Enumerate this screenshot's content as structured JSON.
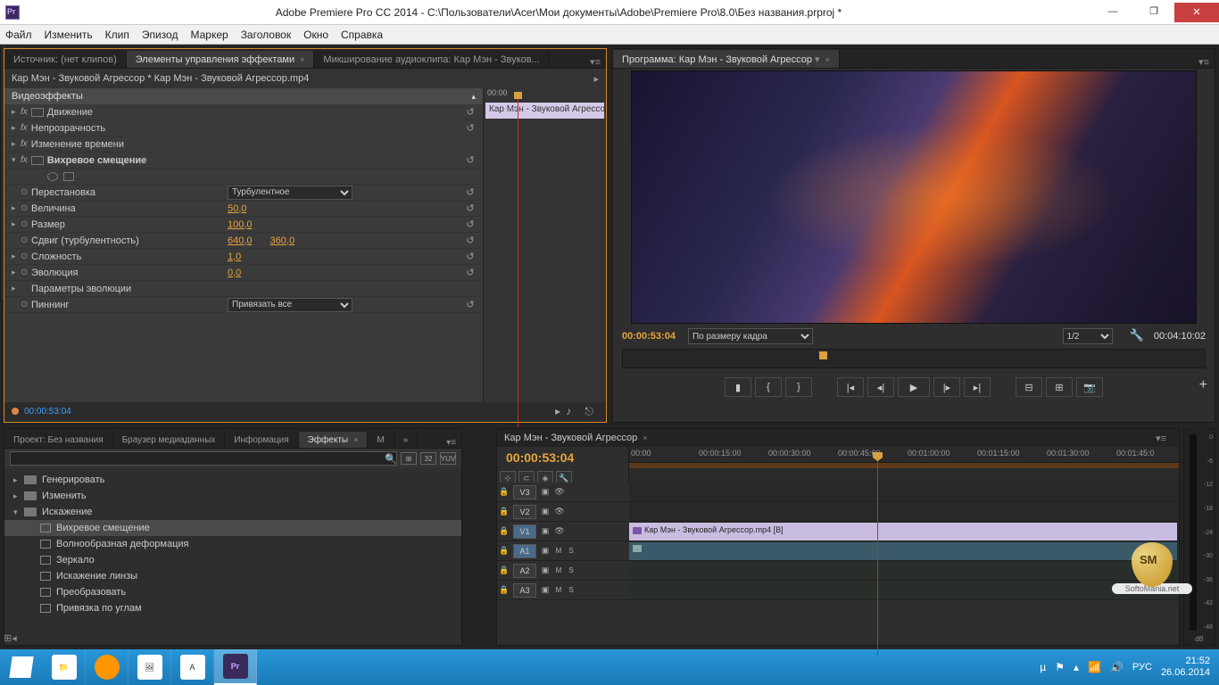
{
  "window": {
    "title": "Adobe Premiere Pro CC 2014 - C:\\Пользователи\\Acer\\Мои документы\\Adobe\\Premiere Pro\\8.0\\Без названия.prproj *"
  },
  "menu": [
    "Файл",
    "Изменить",
    "Клип",
    "Эпизод",
    "Маркер",
    "Заголовок",
    "Окно",
    "Справка"
  ],
  "fx_panel": {
    "tabs": {
      "source": "Источник: (нет клипов)",
      "controls": "Элементы управления эффектами",
      "mixer": "Микширование аудиоклипа: Кар Мэн - Звуков..."
    },
    "clip_path": "Кар Мэн - Звуковой Агрессор * Кар Мэн - Звуковой Агрессор.mp4",
    "section": "Видеоэффекты",
    "rows": {
      "motion": "Движение",
      "opacity": "Непрозрачность",
      "timeremap": "Изменение времени",
      "twirl": "Вихревое смещение",
      "swap": "Перестановка",
      "swap_val": "Турбулентное",
      "amount": "Величина",
      "amount_val": "50,0",
      "size": "Размер",
      "size_val": "100,0",
      "offset": "Сдвиг (турбулентность)",
      "offset_x": "640,0",
      "offset_y": "360,0",
      "complex": "Сложность",
      "complex_val": "1,0",
      "evolve": "Эволюция",
      "evolve_val": "0,0",
      "evparams": "Параметры эволюции",
      "pinning": "Пиннинг",
      "pinning_val": "Привязать все"
    },
    "mini_ruler": "00:00",
    "mini_clip": "Кар Мэн - Звуковой Агрессо",
    "timecode": "00:00:53:04"
  },
  "program": {
    "tab": "Программа: Кар Мэн - Звуковой Агрессор",
    "tc_left": "00:00:53:04",
    "zoom": "По размеру кадра",
    "res": "1/2",
    "tc_right": "00:04:10:02"
  },
  "project": {
    "tabs": {
      "project": "Проект: Без названия",
      "media": "Браузер медиаданных",
      "info": "Информация",
      "effects": "Эффекты",
      "m": "M",
      "arrow": "»"
    },
    "search_placeholder": "",
    "badges": [
      "⊞",
      "32",
      "YUV"
    ],
    "tree": {
      "gen": "Генерировать",
      "edit": "Изменить",
      "distort": "Искажение",
      "items": [
        "Вихревое смещение",
        "Волнообразная деформация",
        "Зеркало",
        "Искажение линзы",
        "Преобразовать",
        "Привязка по углам"
      ]
    }
  },
  "timeline": {
    "seq": "Кар Мэн - Звуковой Агрессор",
    "tc": "00:00:53:04",
    "ruler": [
      "00:00",
      "00:00:15:00",
      "00:00:30:00",
      "00:00:45:00",
      "00:01:00:00",
      "00:01:15:00",
      "00:01:30:00",
      "00:01:45:0"
    ],
    "tracks": {
      "v3": "V3",
      "v2": "V2",
      "v1": "V1",
      "a1": "A1",
      "a2": "A2",
      "a3": "A3"
    },
    "clip_v1": "Кар Мэн - Звуковой Агрессор.mp4 [В]",
    "m": "M",
    "s": "S"
  },
  "meters": {
    "ticks": [
      "0",
      "-6",
      "-12",
      "-18",
      "-24",
      "-30",
      "-36",
      "-42",
      "-48"
    ],
    "unit": "dB"
  },
  "taskbar": {
    "lang": "РУС",
    "time": "21:52",
    "date": "26.06.2014"
  },
  "watermark": "SoftoMania.net"
}
